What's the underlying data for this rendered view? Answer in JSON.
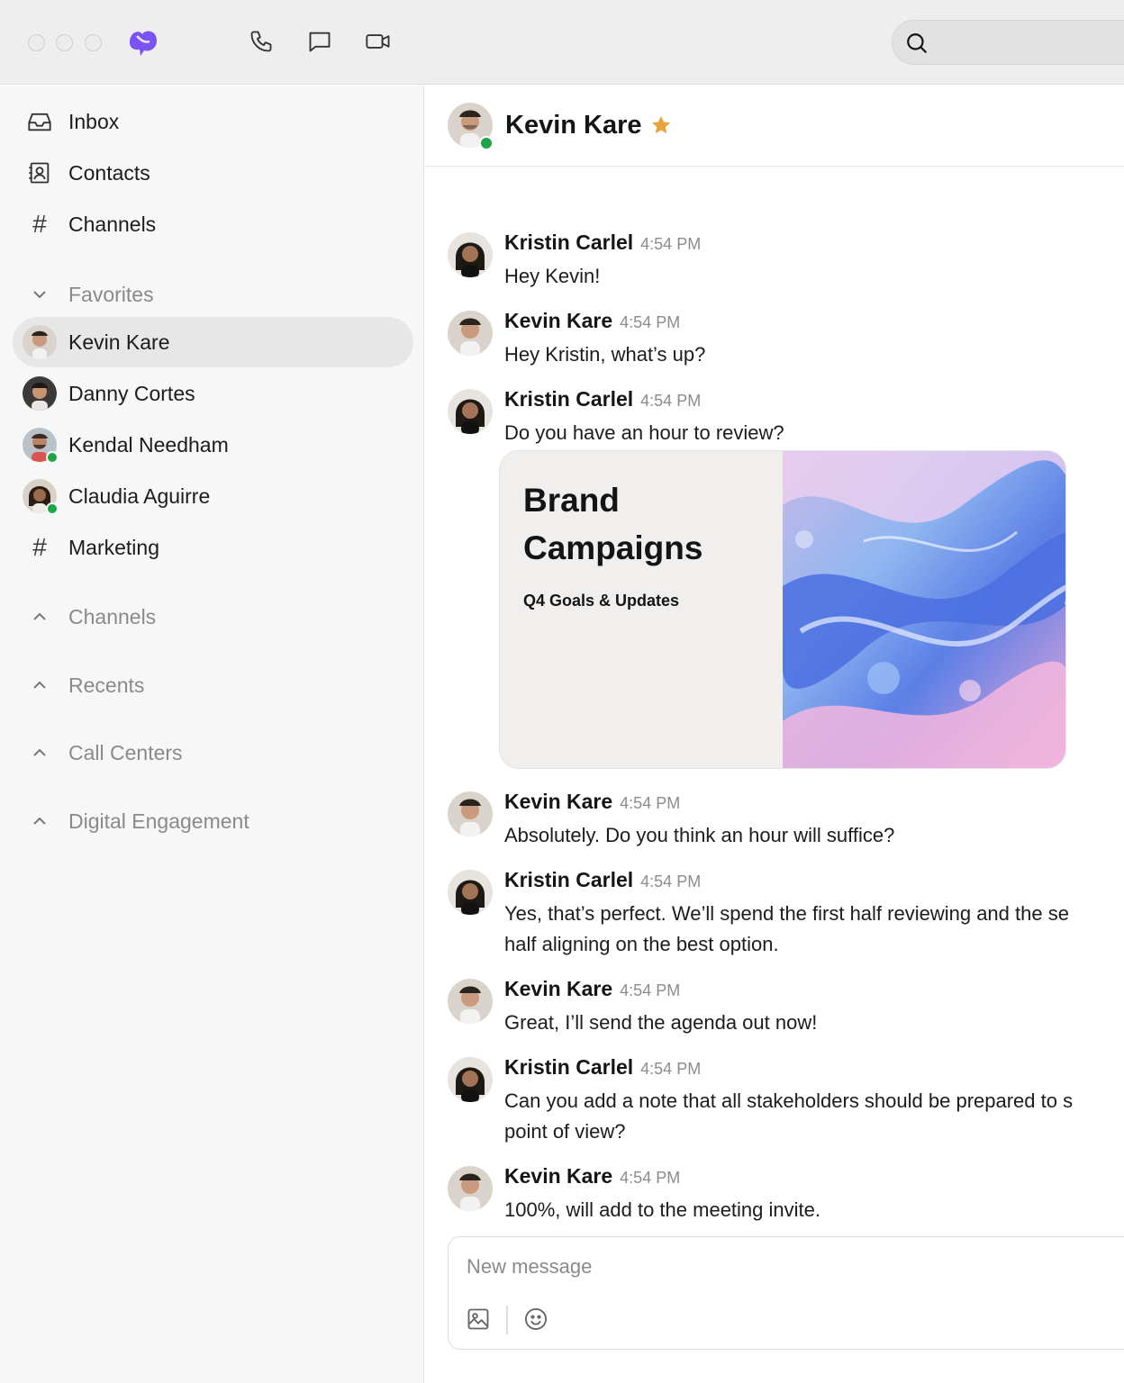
{
  "app": {
    "window_controls": [
      "close",
      "minimize",
      "maximize"
    ],
    "logo_icon": "dialpad-logo-icon",
    "brand_color": "#7c52f4",
    "toolbar": [
      {
        "name": "phone-icon"
      },
      {
        "name": "message-icon"
      },
      {
        "name": "video-icon"
      }
    ],
    "search": {
      "placeholder": "",
      "icon": "search-icon"
    }
  },
  "sidebar": {
    "nav": [
      {
        "label": "Inbox",
        "icon": "inbox-icon"
      },
      {
        "label": "Contacts",
        "icon": "contacts-icon"
      },
      {
        "label": "Channels",
        "icon": "hash-icon"
      }
    ],
    "favorites": {
      "label": "Favorites",
      "expanded": true,
      "items": [
        {
          "label": "Kevin Kare",
          "type": "contact",
          "selected": true,
          "online": false
        },
        {
          "label": "Danny Cortes",
          "type": "contact",
          "selected": false,
          "online": false
        },
        {
          "label": "Kendal Needham",
          "type": "contact",
          "selected": false,
          "online": true
        },
        {
          "label": "Claudia Aguirre",
          "type": "contact",
          "selected": false,
          "online": true
        },
        {
          "label": "Marketing",
          "type": "channel",
          "selected": false,
          "online": false
        }
      ]
    },
    "sections": [
      {
        "label": "Channels",
        "expanded": false
      },
      {
        "label": "Recents",
        "expanded": false
      },
      {
        "label": "Call Centers",
        "expanded": false
      },
      {
        "label": "Digital Engagement",
        "expanded": false
      }
    ]
  },
  "chat": {
    "contact_name": "Kevin Kare",
    "favorite": true,
    "online": true,
    "star_color": "#e8a33a",
    "presence_color": "#1fa34a",
    "messages": [
      {
        "sender": "Kristin Carlel",
        "time": "4:54 PM",
        "text": "Hey Kevin!"
      },
      {
        "sender": "Kevin Kare",
        "time": "4:54 PM",
        "text": "Hey Kristin, what’s up?"
      },
      {
        "sender": "Kristin Carlel",
        "time": "4:54 PM",
        "text": "Do you have an hour to review?",
        "attachment": {
          "title": "Brand\nCampaigns",
          "subtitle": "Q4 Goals & Updates"
        }
      },
      {
        "sender": "Kevin Kare",
        "time": "4:54 PM",
        "text": "Absolutely. Do you think an hour will suffice?"
      },
      {
        "sender": "Kristin Carlel",
        "time": "4:54 PM",
        "text": "Yes, that’s perfect. We’ll spend the first half reviewing and the se",
        "text_line2": "half aligning on the best option."
      },
      {
        "sender": "Kevin Kare",
        "time": "4:54 PM",
        "text": "Great, I’ll send the agenda out now!"
      },
      {
        "sender": "Kristin Carlel",
        "time": "4:54 PM",
        "text": "Can you add a note that all stakeholders should be prepared to s",
        "text_line2": "point of view?"
      },
      {
        "sender": "Kevin Kare",
        "time": "4:54 PM",
        "text": "100%, will add to the meeting invite."
      }
    ],
    "composer": {
      "placeholder": "New message",
      "value": "",
      "tools": [
        "image-icon",
        "emoji-icon"
      ]
    }
  }
}
